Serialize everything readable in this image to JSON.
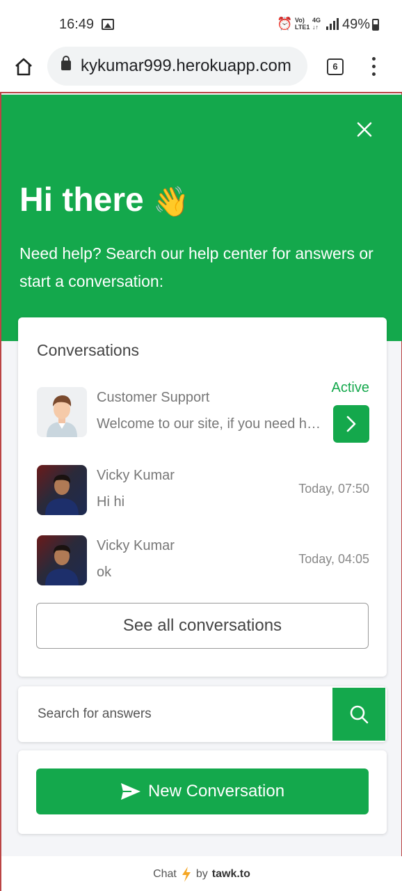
{
  "status_bar": {
    "time": "16:49",
    "network_top": "Vo)",
    "network_bottom": "LTE1",
    "data_top": "4G",
    "data_bottom": "↓↑",
    "battery": "49%"
  },
  "browser": {
    "url": "kykumar999.herokuapp.com",
    "tab_count": "6"
  },
  "hero": {
    "title": "Hi there",
    "wave": "👋",
    "subtitle": "Need help? Search our help center for answers or start a conversation:"
  },
  "conversations": {
    "heading": "Conversations",
    "items": [
      {
        "name": "Customer Support",
        "message": "Welcome to our site, if you need help simply reply to this message",
        "status": "Active"
      },
      {
        "name": "Vicky Kumar",
        "message": "Hi hi",
        "time": "Today, 07:50"
      },
      {
        "name": "Vicky Kumar",
        "message": "ok",
        "time": "Today, 04:05"
      }
    ],
    "see_all_label": "See all conversations"
  },
  "search": {
    "placeholder": "Search for answers"
  },
  "new_conversation": {
    "label": "New Conversation"
  },
  "footer": {
    "prefix": "Chat",
    "by": "by",
    "brand": "tawk.to"
  },
  "colors": {
    "brand_green": "#14a84c",
    "background": "#f4f5f8"
  }
}
